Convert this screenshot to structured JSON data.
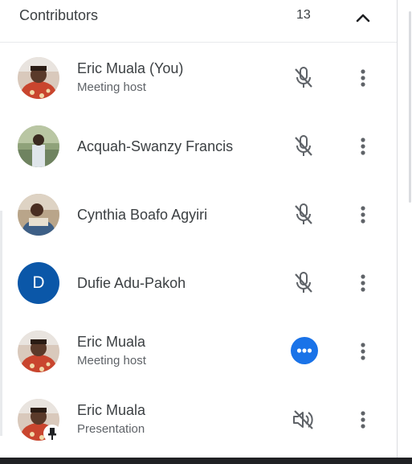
{
  "panel": {
    "title": "Contributors",
    "count": "13"
  },
  "participants": [
    {
      "name": "Eric Muala (You)",
      "role": "Meeting host",
      "initial": "",
      "status": "mic-off-icon"
    },
    {
      "name": "Acquah-Swanzy Francis",
      "role": "",
      "initial": "",
      "status": "mic-off-icon"
    },
    {
      "name": "Cynthia Boafo Agyiri",
      "role": "",
      "initial": "",
      "status": "mic-off-icon"
    },
    {
      "name": "Dufie Adu-Pakoh",
      "role": "",
      "initial": "D",
      "status": "mic-off-icon"
    },
    {
      "name": "Eric Muala",
      "role": "Meeting host",
      "initial": "",
      "status": "more-options-blue-icon"
    },
    {
      "name": "Eric Muala",
      "role": "Presentation",
      "initial": "",
      "status": "volume-off-icon"
    }
  ],
  "colors": {
    "accent": "#1a73e8",
    "avatar_letter_bg": "#0b57a8",
    "text_primary": "#3c4043",
    "text_secondary": "#5f6368",
    "icon_gray": "#5f6368"
  }
}
